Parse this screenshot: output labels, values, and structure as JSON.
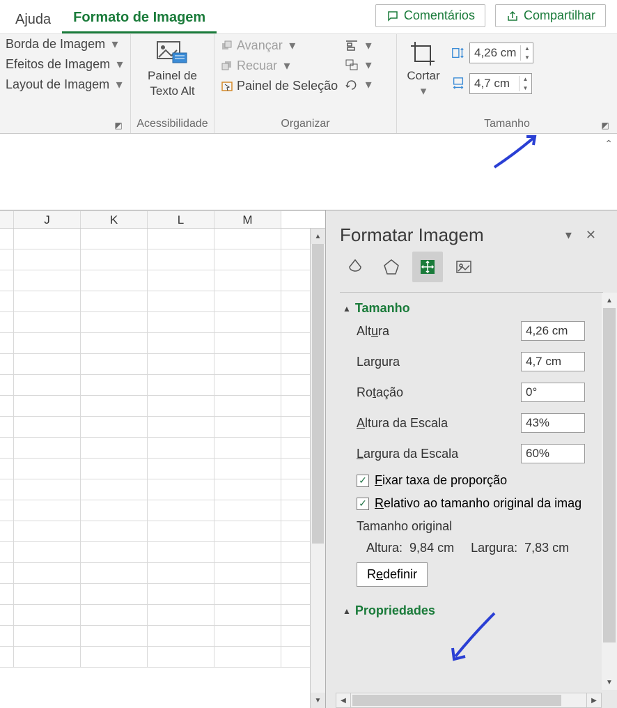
{
  "tabs": {
    "help": "Ajuda",
    "pictureFormat": "Formato de Imagem"
  },
  "actions": {
    "comments": "Comentários",
    "share": "Compartilhar"
  },
  "ribbon": {
    "group1": {
      "border": "Borda de Imagem",
      "effects": "Efeitos de Imagem",
      "layout": "Layout de Imagem"
    },
    "acc": {
      "btn": "Painel de\nTexto Alt",
      "label": "Acessibilidade",
      "btn_l1": "Painel de",
      "btn_l2": "Texto Alt"
    },
    "arrange": {
      "forward": "Avançar",
      "backward": "Recuar",
      "selectionPane": "Painel de Seleção",
      "label": "Organizar"
    },
    "size": {
      "crop": "Cortar",
      "height": "4,26 cm",
      "width": "4,7 cm",
      "label": "Tamanho"
    }
  },
  "columns": [
    "J",
    "K",
    "L",
    "M"
  ],
  "pane": {
    "title": "Formatar Imagem",
    "sections": {
      "size": {
        "title": "Tamanho",
        "height_l": "Altura",
        "height_v": "4,26 cm",
        "width_l": "Largura",
        "width_v": "4,7 cm",
        "rotation_l": "Rotação",
        "rotation_v": "0°",
        "scaleH_l": "Altura da Escala",
        "scaleH_v": "43%",
        "scaleW_l": "Largura da Escala",
        "scaleW_v": "60%",
        "lock": "Fixar taxa de proporção",
        "lock_pre": "F",
        "lock_rest": "ixar taxa de proporção",
        "relative": "Relativo ao tamanho original da imagem",
        "relative_pre": "R",
        "relative_rest": "elativo ao tamanho original da imag",
        "original": "Tamanho original",
        "origH_l": "Altura:",
        "origH_v": "9,84 cm",
        "origW_l": "Largura:",
        "origW_v": "7,83 cm",
        "reset": "Redefinir",
        "reset_pre": "R",
        "reset_mid": "e",
        "reset_rest": "definir"
      },
      "props": {
        "title": "Propriedades"
      }
    }
  }
}
